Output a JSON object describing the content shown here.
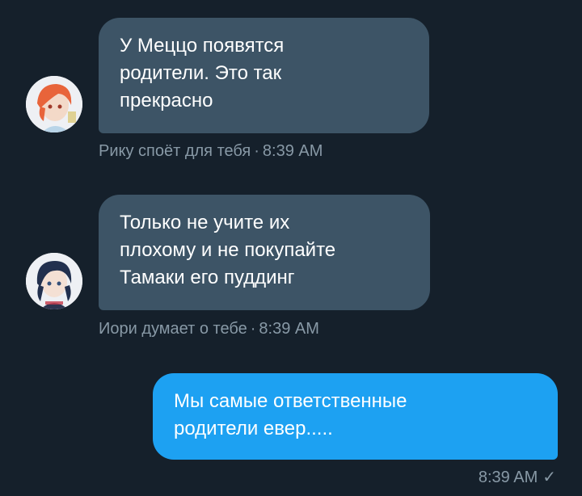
{
  "messages": [
    {
      "direction": "incoming",
      "lines": [
        "У Меццо появятся",
        "родители. Это так",
        "прекрасно"
      ],
      "sender": "Рику споёт для тебя",
      "time": "8:39 AM",
      "avatar": "red-haired-character-avatar"
    },
    {
      "direction": "incoming",
      "lines": [
        "Только не учите их",
        "плохому и не покупайте",
        "Тамаки его пуддинг"
      ],
      "sender": "Иори думает о тебе",
      "time": "8:39 AM",
      "avatar": "dark-haired-character-avatar"
    },
    {
      "direction": "outgoing",
      "lines": [
        "Мы самые ответственные",
        "родители евер....."
      ],
      "time": "8:39 AM",
      "status_icon": "checkmark-icon",
      "status_glyph": "✓"
    }
  ],
  "colors": {
    "background": "#15202b",
    "incoming_bubble": "#3d5466",
    "outgoing_bubble": "#1da1f2",
    "meta_text": "#8899a6"
  }
}
